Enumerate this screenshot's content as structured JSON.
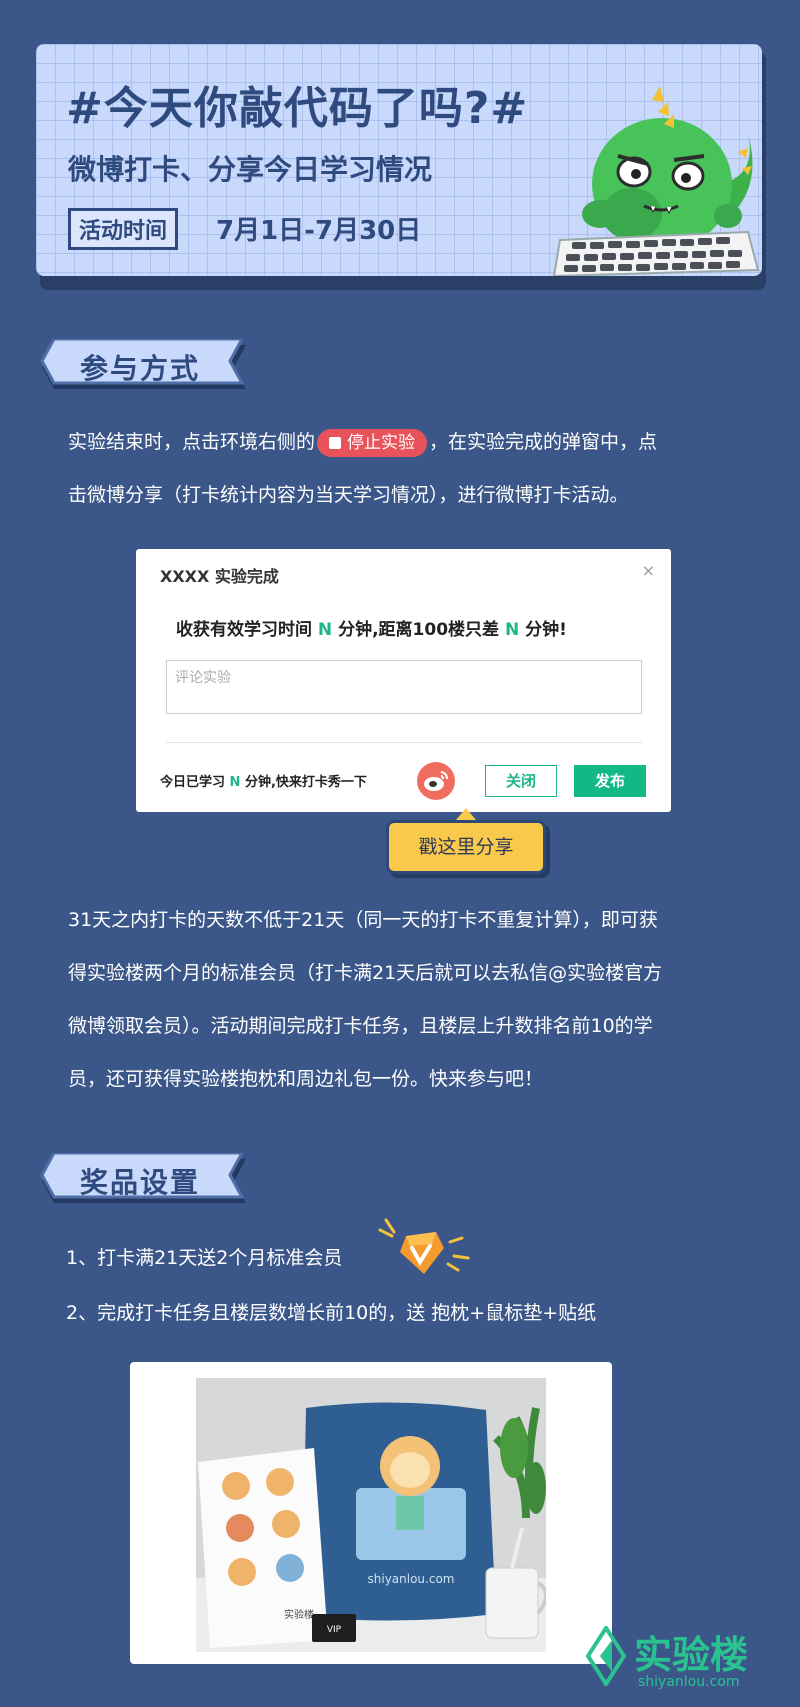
{
  "banner": {
    "title": "#今天你敲代码了吗?#",
    "subtitle": "微博打卡、分享今日学习情况",
    "tag": "活动时间",
    "date": "7月1日-7月30日"
  },
  "section_join": {
    "heading": "参与方式",
    "line1_pre": "实验结束时，点击环境右侧的",
    "stop_button": "停止实验",
    "line1_post": "，在实验完成的弹窗中，点",
    "line2": "击微博分享（打卡统计内容为当天学习情况），进行微博打卡活动。"
  },
  "dialog": {
    "title": "XXXX 实验完成",
    "close_x": "×",
    "msg_a": "收获有效学习时间 ",
    "msg_n1": "N",
    "msg_b": " 分钟,距离100楼只差 ",
    "msg_n2": "N",
    "msg_c": " 分钟!",
    "placeholder": "评论实验",
    "foot_a": "今日已学习 ",
    "foot_n": "N",
    "foot_b": " 分钟,快来打卡秀一下",
    "close_btn": "关闭",
    "publish_btn": "发布",
    "share_callout": "戳这里分享"
  },
  "rules": {
    "lines": [
      "31天之内打卡的天数不低于21天（同一天的打卡不重复计算），即可获",
      "得实验楼两个月的标准会员（打卡满21天后就可以去私信@实验楼官方",
      "微博领取会员）。活动期间完成打卡任务，且楼层上升数排名前10的学",
      "员，还可获得实验楼抱枕和周边礼包一份。快来参与吧！"
    ]
  },
  "section_prize": {
    "heading": "奖品设置",
    "items": [
      "1、打卡满21天送2个月标准会员",
      "2、完成打卡任务且楼层数增长前10的，送 抱枕+鼠标垫+贴纸"
    ]
  },
  "photo": {
    "pillow_text": "shiyanlou.com",
    "card_text": "VIP",
    "sticker_brand": "实验楼"
  },
  "watermark": {
    "brand": "实验楼",
    "url": "shiyanlou.com"
  },
  "colors": {
    "background": "#3b5789",
    "banner_ink": "#2f4a7e",
    "accent_green": "#1fb58a",
    "stop_red": "#e8525a",
    "callout_yellow": "#f9c94b"
  }
}
